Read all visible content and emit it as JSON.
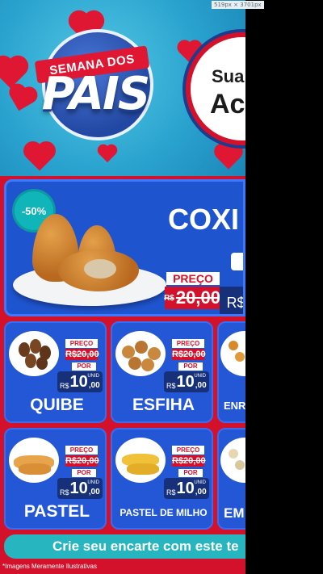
{
  "screenshot_label": "519px × 3701px",
  "hero": {
    "ribbon": "SEMANA DOS",
    "title": "PAIS",
    "bubble_line1": "Sua",
    "bubble_line2": "Ac"
  },
  "featured": {
    "discount": "-50%",
    "title": "COXI",
    "preco_label": "PREÇO",
    "old_price": "20,00",
    "old_currency": "R$",
    "new_price": "R$"
  },
  "products": [
    {
      "name": "QUIBE",
      "preco_label": "PREÇO",
      "old_price": "R$20,00",
      "por_label": "POR",
      "currency": "R$",
      "price_big": "10",
      "price_cents": ",00",
      "unid": "UNID"
    },
    {
      "name": "ESFIHA",
      "preco_label": "PREÇO",
      "old_price": "R$20,00",
      "por_label": "POR",
      "currency": "R$",
      "price_big": "10",
      "price_cents": ",00",
      "unid": "UNID"
    },
    {
      "name": "ENR"
    },
    {
      "name": "PASTEL",
      "preco_label": "PREÇO",
      "old_price": "R$20,00",
      "por_label": "POR",
      "currency": "R$",
      "price_big": "10",
      "price_cents": ",00",
      "unid": "UNID"
    },
    {
      "name": "PASTEL DE MILHO",
      "preco_label": "PREÇO",
      "old_price": "R$20,00",
      "por_label": "POR",
      "currency": "R$",
      "price_big": "10",
      "price_cents": ",00",
      "unid": "UNID"
    },
    {
      "name": "EM"
    }
  ],
  "cta": "Crie seu encarte com este te",
  "footer": "*Imagens Meramente Ilustrativas",
  "colors": {
    "red": "#d4112a",
    "blue": "#2457d6",
    "navy": "#16307a",
    "teal": "#27b5bf",
    "sky": "#2aa3cf"
  }
}
